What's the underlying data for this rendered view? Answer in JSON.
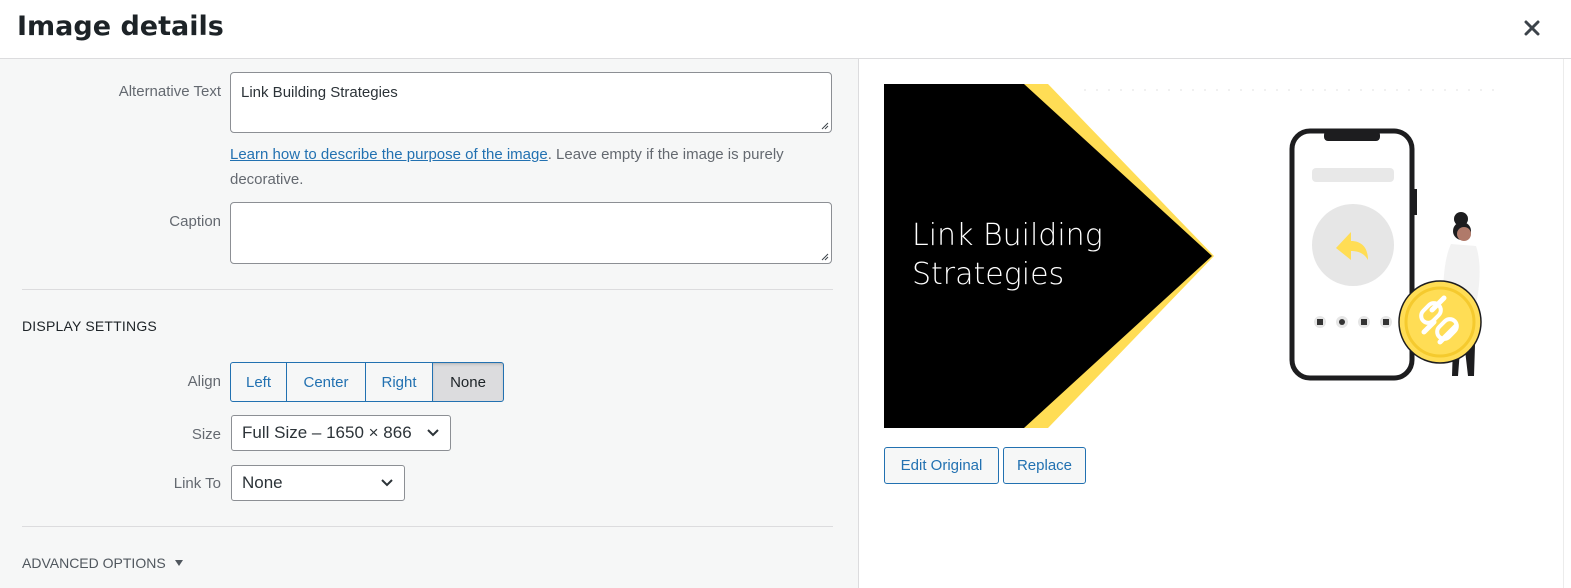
{
  "header": {
    "title": "Image details",
    "close_icon": "close-icon"
  },
  "fields": {
    "alt_text": {
      "label": "Alternative Text",
      "value": "Link Building Strategies"
    },
    "help": {
      "link_text": "Learn how to describe the purpose of the image",
      "text": ". Leave empty if the image is purely decorative."
    },
    "caption": {
      "label": "Caption",
      "value": ""
    }
  },
  "display_settings": {
    "heading": "DISPLAY SETTINGS",
    "align": {
      "label": "Align",
      "options": [
        "Left",
        "Center",
        "Right",
        "None"
      ],
      "selected": "None"
    },
    "size": {
      "label": "Size",
      "value": "Full Size – 1650 × 866"
    },
    "link_to": {
      "label": "Link To",
      "value": "None"
    }
  },
  "advanced": {
    "label": "ADVANCED OPTIONS",
    "icon": "triangle-down-icon"
  },
  "preview": {
    "text": "Link Building Strategies",
    "colors": {
      "black": "#000000",
      "yellow": "#ffdd55"
    },
    "buttons": {
      "edit_original": "Edit Original",
      "replace": "Replace"
    }
  }
}
